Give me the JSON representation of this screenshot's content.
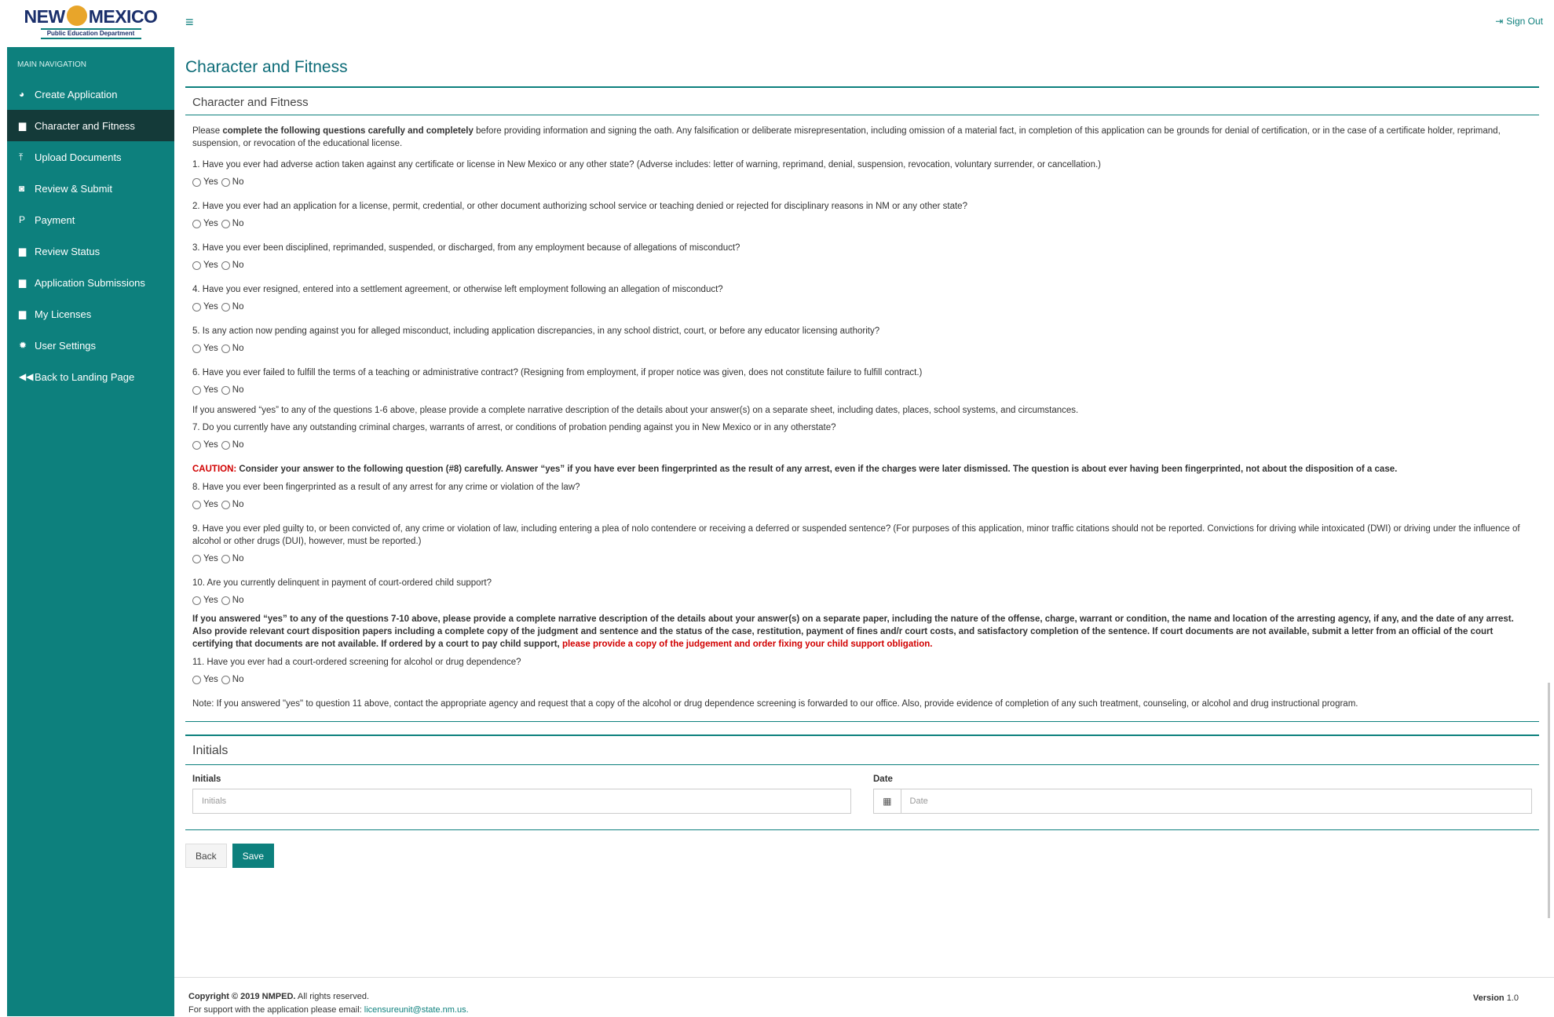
{
  "header": {
    "logo_text": "NEW MEXICO",
    "logo_left": "NEW",
    "logo_right": "MEXICO",
    "logo_sub": "Public Education Department",
    "menu_icon": "hamburger-icon",
    "sign_out": "Sign Out",
    "sign_out_icon": "sign-out-icon"
  },
  "sidebar": {
    "header": "MAIN NAVIGATION",
    "items": [
      {
        "label": "Create Application",
        "icon": "globe-icon",
        "glyph": "◕",
        "active": false
      },
      {
        "label": "Character and Fitness",
        "icon": "folder-icon",
        "glyph": "▆",
        "active": true
      },
      {
        "label": "Upload Documents",
        "icon": "upload-icon",
        "glyph": "⤒",
        "active": false
      },
      {
        "label": "Review & Submit",
        "icon": "camera-icon",
        "glyph": "◙",
        "active": false
      },
      {
        "label": "Payment",
        "icon": "paypal-icon",
        "glyph": "P",
        "active": false
      },
      {
        "label": "Review Status",
        "icon": "folder-open-icon",
        "glyph": "▆",
        "active": false
      },
      {
        "label": "Application Submissions",
        "icon": "folder-icon",
        "glyph": "▆",
        "active": false
      },
      {
        "label": "My Licenses",
        "icon": "folder-icon",
        "glyph": "▆",
        "active": false
      },
      {
        "label": "User Settings",
        "icon": "gear-icon",
        "glyph": "✹",
        "active": false
      },
      {
        "label": "Back to Landing Page",
        "icon": "backward-icon",
        "glyph": "◀◀",
        "active": false
      }
    ]
  },
  "page": {
    "title": "Character and Fitness",
    "section_title": "Character and Fitness",
    "intro_pre": "Please ",
    "intro_bold": "complete the following questions carefully and completely",
    "intro_post": " before providing information and signing the oath. Any falsification or deliberate misrepresentation, including omission of a material fact, in completion of this application can be grounds for denial of certification, or in the case of a certificate holder, reprimand, suspension, or revocation of the educational license.",
    "yes_label": "Yes",
    "no_label": "No",
    "q1": "1. Have you ever had adverse action taken against any certificate or license in New Mexico or any other state? (Adverse includes: letter of warning, reprimand, denial, suspension, revocation, voluntary surrender, or cancellation.)",
    "q2": "2. Have you ever had an application for a license, permit, credential, or other document authorizing school service or teaching denied or rejected for disciplinary reasons in NM or any other state?",
    "q3": "3. Have you ever been disciplined, reprimanded, suspended, or discharged, from any employment because of allegations of misconduct?",
    "q4": "4. Have you ever resigned, entered into a settlement agreement, or otherwise left employment following an allegation of misconduct?",
    "q5": "5. Is any action now pending against you for alleged misconduct, including application discrepancies, in any school district, court, or before any educator licensing authority?",
    "q6": "6. Have you ever failed to fulfill the terms of a teaching or administrative contract? (Resigning from employment, if proper notice was given, does not constitute failure to fulfill contract.)",
    "note_1_6": "If you answered “yes” to any of the questions 1-6 above, please provide a complete narrative description of the details about your answer(s) on a separate sheet, including dates, places, school systems, and circumstances.",
    "q7": "7. Do you currently have any outstanding criminal charges, warrants of arrest, or conditions of probation pending against you in New Mexico or in any otherstate?",
    "caution_label": "CAUTION:",
    "caution_text": " Consider your answer to the following question (#8) carefully. Answer “yes” if you have ever been fingerprinted as the result of any arrest, even if the charges were later dismissed. The question is about ever having been fingerprinted, not about the disposition of a case.",
    "q8": "8. Have you ever been fingerprinted as a result of any arrest for any crime or violation of the law?",
    "q9": "9. Have you ever pled guilty to, or been convicted of, any crime or violation of law, including entering a plea of nolo contendere or receiving a deferred or suspended sentence? (For purposes of this application, minor traffic citations should not be reported. Convictions for driving while intoxicated (DWI) or driving under the influence of alcohol or other drugs (DUI), however, must be reported.)",
    "q10": "10. Are you currently delinquent in payment of court-ordered child support?",
    "note_7_10": "If you answered “yes” to any of the questions 7-10 above, please provide a complete narrative description of the details about your answer(s) on a separate paper, including the nature of the offense, charge, warrant or condition, the name and location of the arresting agency, if any, and the date of any arrest. Also provide relevant court disposition papers including a complete copy of the judgment and sentence and the status of the case, restitution, payment of fines and/r court costs, and satisfactory completion of the sentence. If court documents are not available, submit a letter from an official of the court certifying that documents are not available. If ordered by a court to pay child support, ",
    "note_7_10_red": "please provide a copy of the judgement and order fixing your child support obligation.",
    "q11": "11. Have you ever had a court-ordered screening for alcohol or drug dependence?",
    "note_11": "Note: If you answered \"yes\" to question 11 above, contact the appropriate agency and request that a copy of the alcohol or drug dependence screening is forwarded to our office. Also, provide evidence of completion of any such treatment, counseling, or alcohol and drug instructional program."
  },
  "initials_section": {
    "title": "Initials",
    "initials_label": "Initials",
    "initials_placeholder": "Initials",
    "date_label": "Date",
    "date_placeholder": "Date",
    "date_icon": "calendar-icon"
  },
  "buttons": {
    "back": "Back",
    "save": "Save"
  },
  "footer": {
    "copyright": "Copyright © 2019 NMPED.",
    "rights": " All rights reserved.",
    "support_text": "For support with the application please email: ",
    "support_email": "licensureunit@state.nm.us.",
    "version_label": "Version",
    "version_value": " 1.0"
  },
  "colors": {
    "primary": "#0d807d",
    "active_nav": "#143a39",
    "caution": "#d10000",
    "title": "#0d6c78"
  }
}
